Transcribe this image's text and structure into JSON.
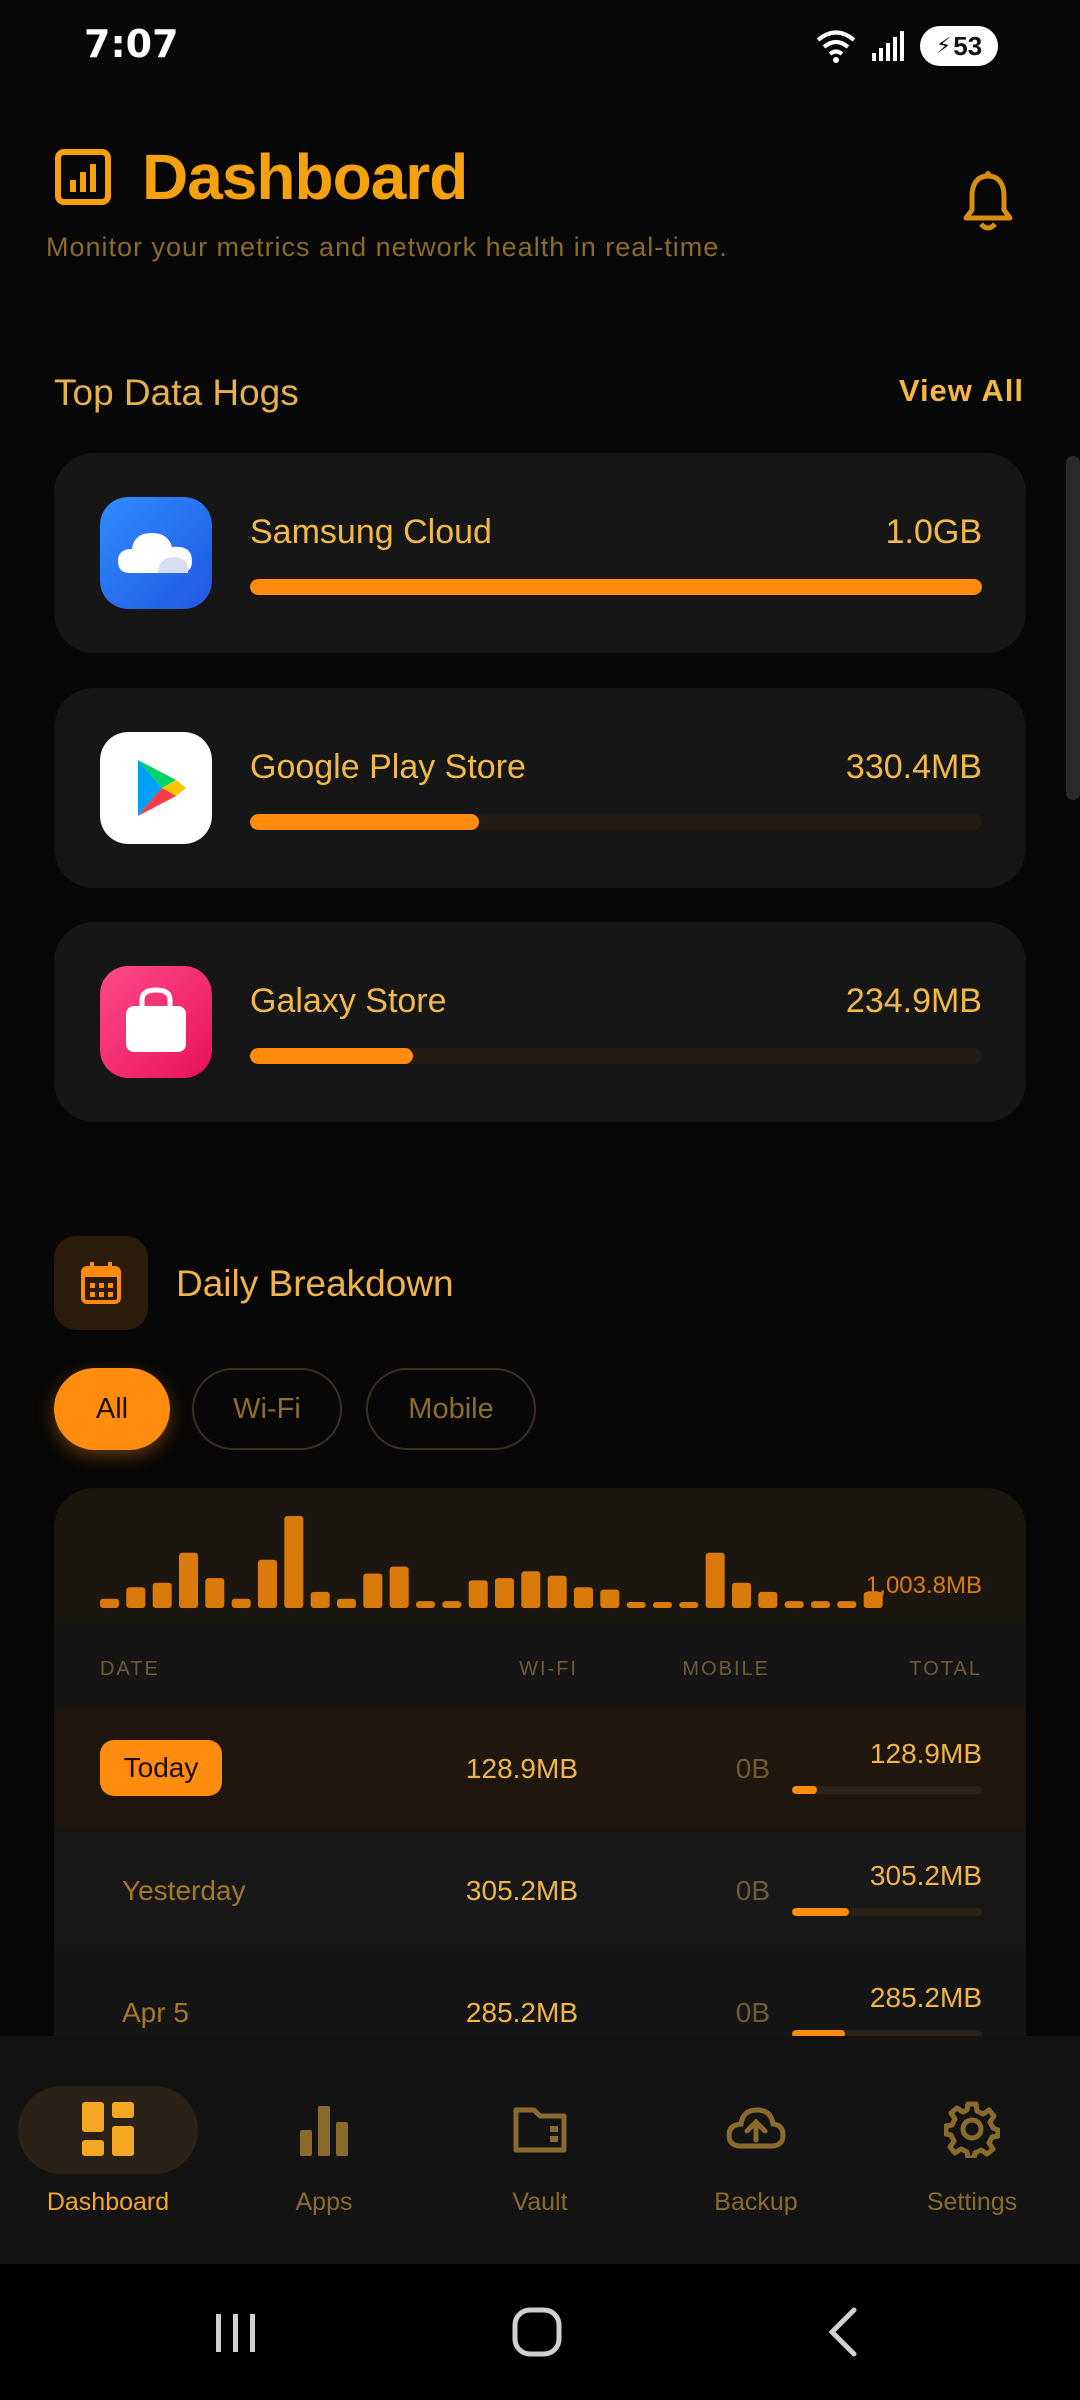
{
  "status_bar": {
    "time": "7:07",
    "battery": "53"
  },
  "header": {
    "title": "Dashboard",
    "subtitle": "Monitor your metrics and network health in real-time."
  },
  "top_hogs": {
    "title": "Top Data Hogs",
    "view_all": "View All",
    "items": [
      {
        "name": "Samsung Cloud",
        "size": "1.0GB",
        "fraction": 1.0,
        "icon": "samsung-cloud-icon",
        "color": "#3478f6"
      },
      {
        "name": "Google Play Store",
        "size": "330.4MB",
        "fraction": 0.313,
        "icon": "google-play-icon",
        "color": "#ffffff"
      },
      {
        "name": "Galaxy Store",
        "size": "234.9MB",
        "fraction": 0.222,
        "icon": "galaxy-store-icon",
        "color": "#ff2d6f"
      }
    ]
  },
  "daily": {
    "title": "Daily Breakdown",
    "filters": [
      "All",
      "Wi-Fi",
      "Mobile"
    ],
    "active_filter": "All",
    "spark_total": "1,003.8MB",
    "spark_values": [
      8,
      18,
      22,
      48,
      26,
      8,
      42,
      80,
      14,
      8,
      30,
      36,
      6,
      6,
      24,
      26,
      32,
      28,
      18,
      16,
      4,
      4,
      4,
      48,
      22,
      14,
      6,
      6,
      6,
      14
    ],
    "columns": {
      "date": "DATE",
      "wifi": "WI-FI",
      "mobile": "MOBILE",
      "total": "TOTAL"
    },
    "rows": [
      {
        "date": "Today",
        "wifi": "128.9MB",
        "mobile": "0B",
        "total": "128.9MB",
        "fraction": 0.13
      },
      {
        "date": "Yesterday",
        "wifi": "305.2MB",
        "mobile": "0B",
        "total": "305.2MB",
        "fraction": 0.3
      },
      {
        "date": "Apr 5",
        "wifi": "285.2MB",
        "mobile": "0B",
        "total": "285.2MB",
        "fraction": 0.28
      }
    ]
  },
  "nav": {
    "items": [
      {
        "label": "Dashboard",
        "icon": "dashboard-icon",
        "active": true
      },
      {
        "label": "Apps",
        "icon": "bar-chart-icon",
        "active": false
      },
      {
        "label": "Vault",
        "icon": "vault-folder-icon",
        "active": false
      },
      {
        "label": "Backup",
        "icon": "cloud-upload-icon",
        "active": false
      },
      {
        "label": "Settings",
        "icon": "settings-gear-icon",
        "active": false
      }
    ]
  },
  "colors": {
    "accent": "#ff8c0e",
    "text_accent": "#f5a623",
    "background": "#070707",
    "card": "#161616"
  }
}
